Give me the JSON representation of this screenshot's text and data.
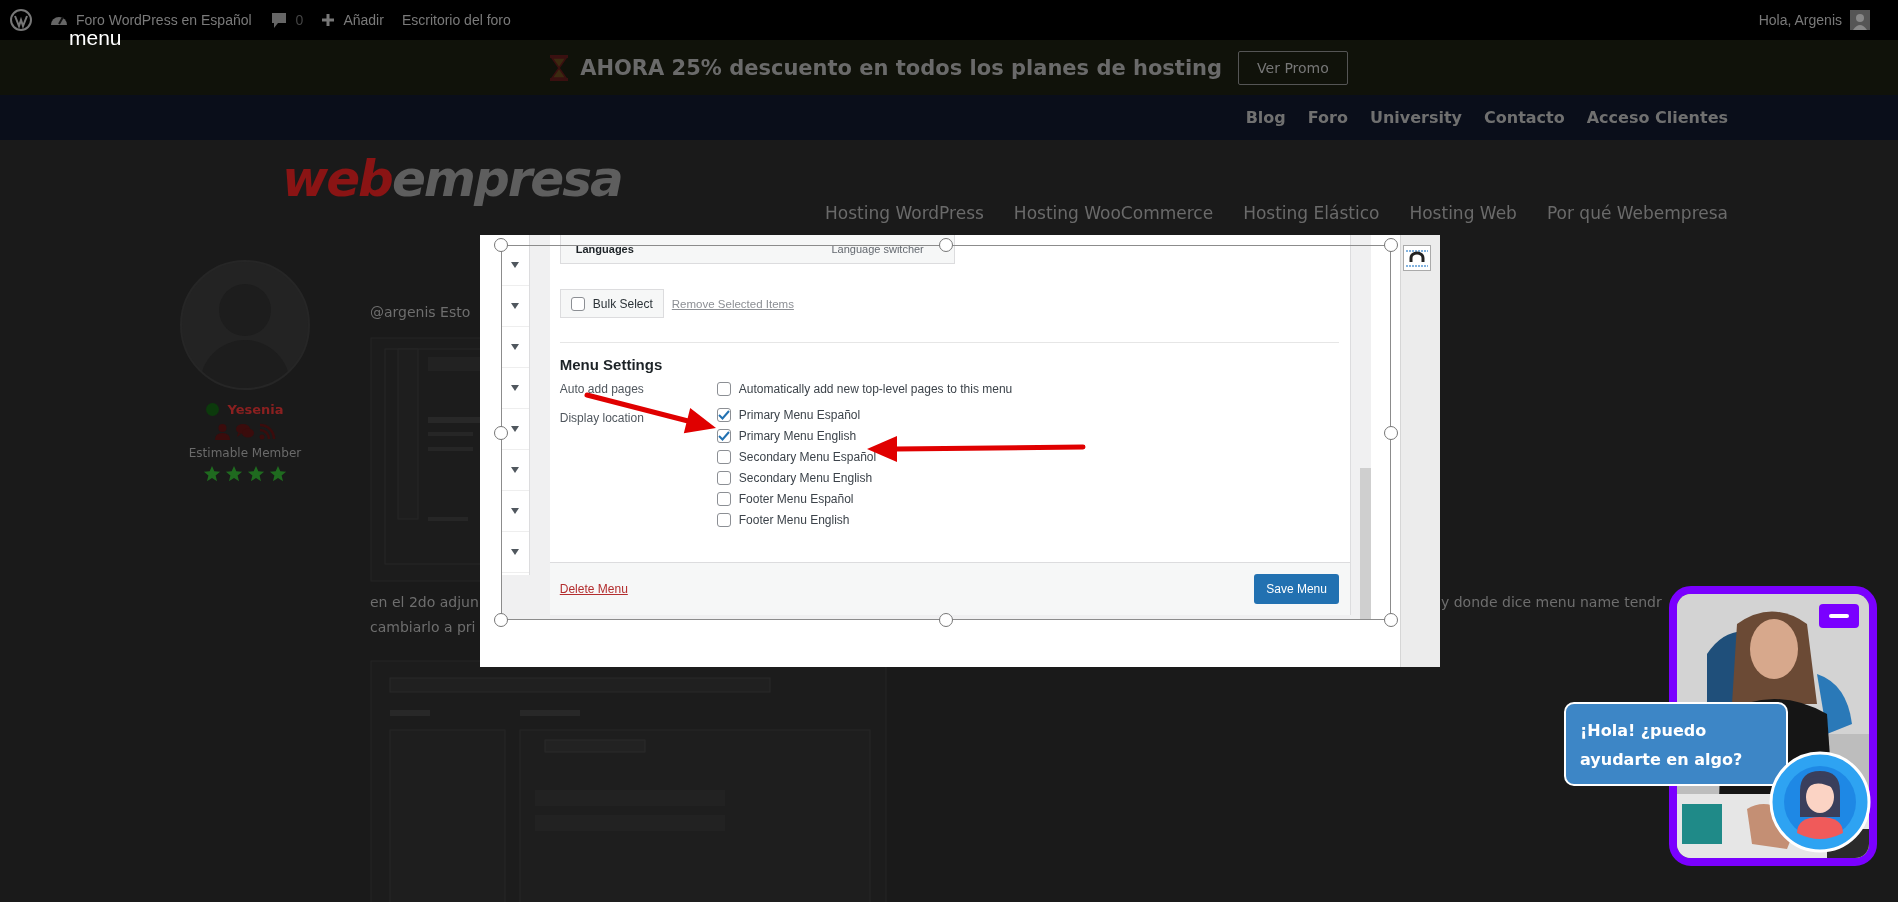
{
  "admin_bar": {
    "site_name": "Foro WordPress en Español",
    "comment_count": "0",
    "new_label": "Añadir",
    "forum_dashboard": "Escritorio del foro",
    "greeting": "Hola, Argenis"
  },
  "menu_label": "menu",
  "promo": {
    "text": "AHORA 25% descuento en todos los planes de hosting",
    "button": "Ver Promo"
  },
  "top_nav": [
    "Blog",
    "Foro",
    "University",
    "Contacto",
    "Acceso Clientes"
  ],
  "logo": {
    "first_part": "web",
    "second_part": "empresa"
  },
  "main_nav": [
    "Hosting WordPress",
    "Hosting WooCommerce",
    "Hosting Elástico",
    "Hosting Web",
    "Por qué Webempresa"
  ],
  "post": {
    "author": {
      "name": "Yesenia",
      "online": true,
      "rank": "Estimable Member",
      "stars": 4
    },
    "intro": "@argenis Esto",
    "second_left": [
      "en el 2do adjun",
      "cambiarlo a pri"
    ],
    "second_right": "y donde dice menu name tendr"
  },
  "lightbox": {
    "menu_item": {
      "title": "Languages",
      "type": "Language switcher"
    },
    "bulk_select": {
      "label": "Bulk Select",
      "checked": false
    },
    "remove_link": "Remove Selected Items",
    "settings_title": "Menu Settings",
    "auto_add": {
      "label": "Auto add pages",
      "option": "Automatically add new top-level pages to this menu",
      "checked": false
    },
    "display_location": {
      "label": "Display location",
      "options": [
        {
          "label": "Primary Menu Español",
          "checked": true
        },
        {
          "label": "Primary Menu English",
          "checked": true
        },
        {
          "label": "Secondary Menu Español",
          "checked": false
        },
        {
          "label": "Secondary Menu English",
          "checked": false
        },
        {
          "label": "Footer Menu Español",
          "checked": false
        },
        {
          "label": "Footer Menu English",
          "checked": false
        }
      ]
    },
    "delete_link": "Delete Menu",
    "save_button": "Save Menu"
  },
  "chat": {
    "message": "¡Hola! ¿puedo ayudarte en algo?"
  }
}
